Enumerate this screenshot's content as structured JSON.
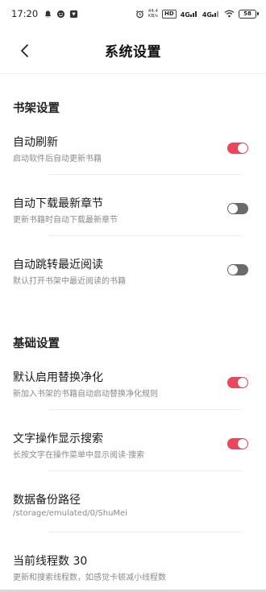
{
  "status_bar": {
    "time": "17:20",
    "speed_value": "44.4",
    "speed_unit": "KB/s",
    "hd_label": "HD",
    "net1": "4G",
    "net2": "4G",
    "battery": "58"
  },
  "header": {
    "title": "系统设置"
  },
  "sections": {
    "bookshelf": {
      "title": "书架设置",
      "auto_refresh": {
        "title": "自动刷新",
        "subtitle": "启动软件后自动更新书籍",
        "enabled": true
      },
      "auto_download": {
        "title": "自动下载最新章节",
        "subtitle": "更新书籍时自动下载最新章节",
        "enabled": false
      },
      "auto_jump": {
        "title": "自动跳转最近阅读",
        "subtitle": "默认打开书架中最近阅读的书籍",
        "enabled": false
      }
    },
    "basic": {
      "title": "基础设置",
      "replace_purify": {
        "title": "默认启用替换净化",
        "subtitle": "新加入书架的书籍自动启动替换净化规则",
        "enabled": true
      },
      "text_search": {
        "title": "文字操作显示搜索",
        "subtitle": "长按文字在操作菜单中显示阅读·搜索",
        "enabled": true
      },
      "backup_path": {
        "title": "数据备份路径",
        "subtitle": "/storage/emulated/0/ShuMei"
      },
      "thread_count": {
        "title": "当前线程数 30",
        "subtitle": "更新和搜索线程数，如感觉卡顿减小线程数"
      }
    }
  },
  "colors": {
    "toggle_on": "#e9475a",
    "toggle_off": "#6b6b6b"
  }
}
